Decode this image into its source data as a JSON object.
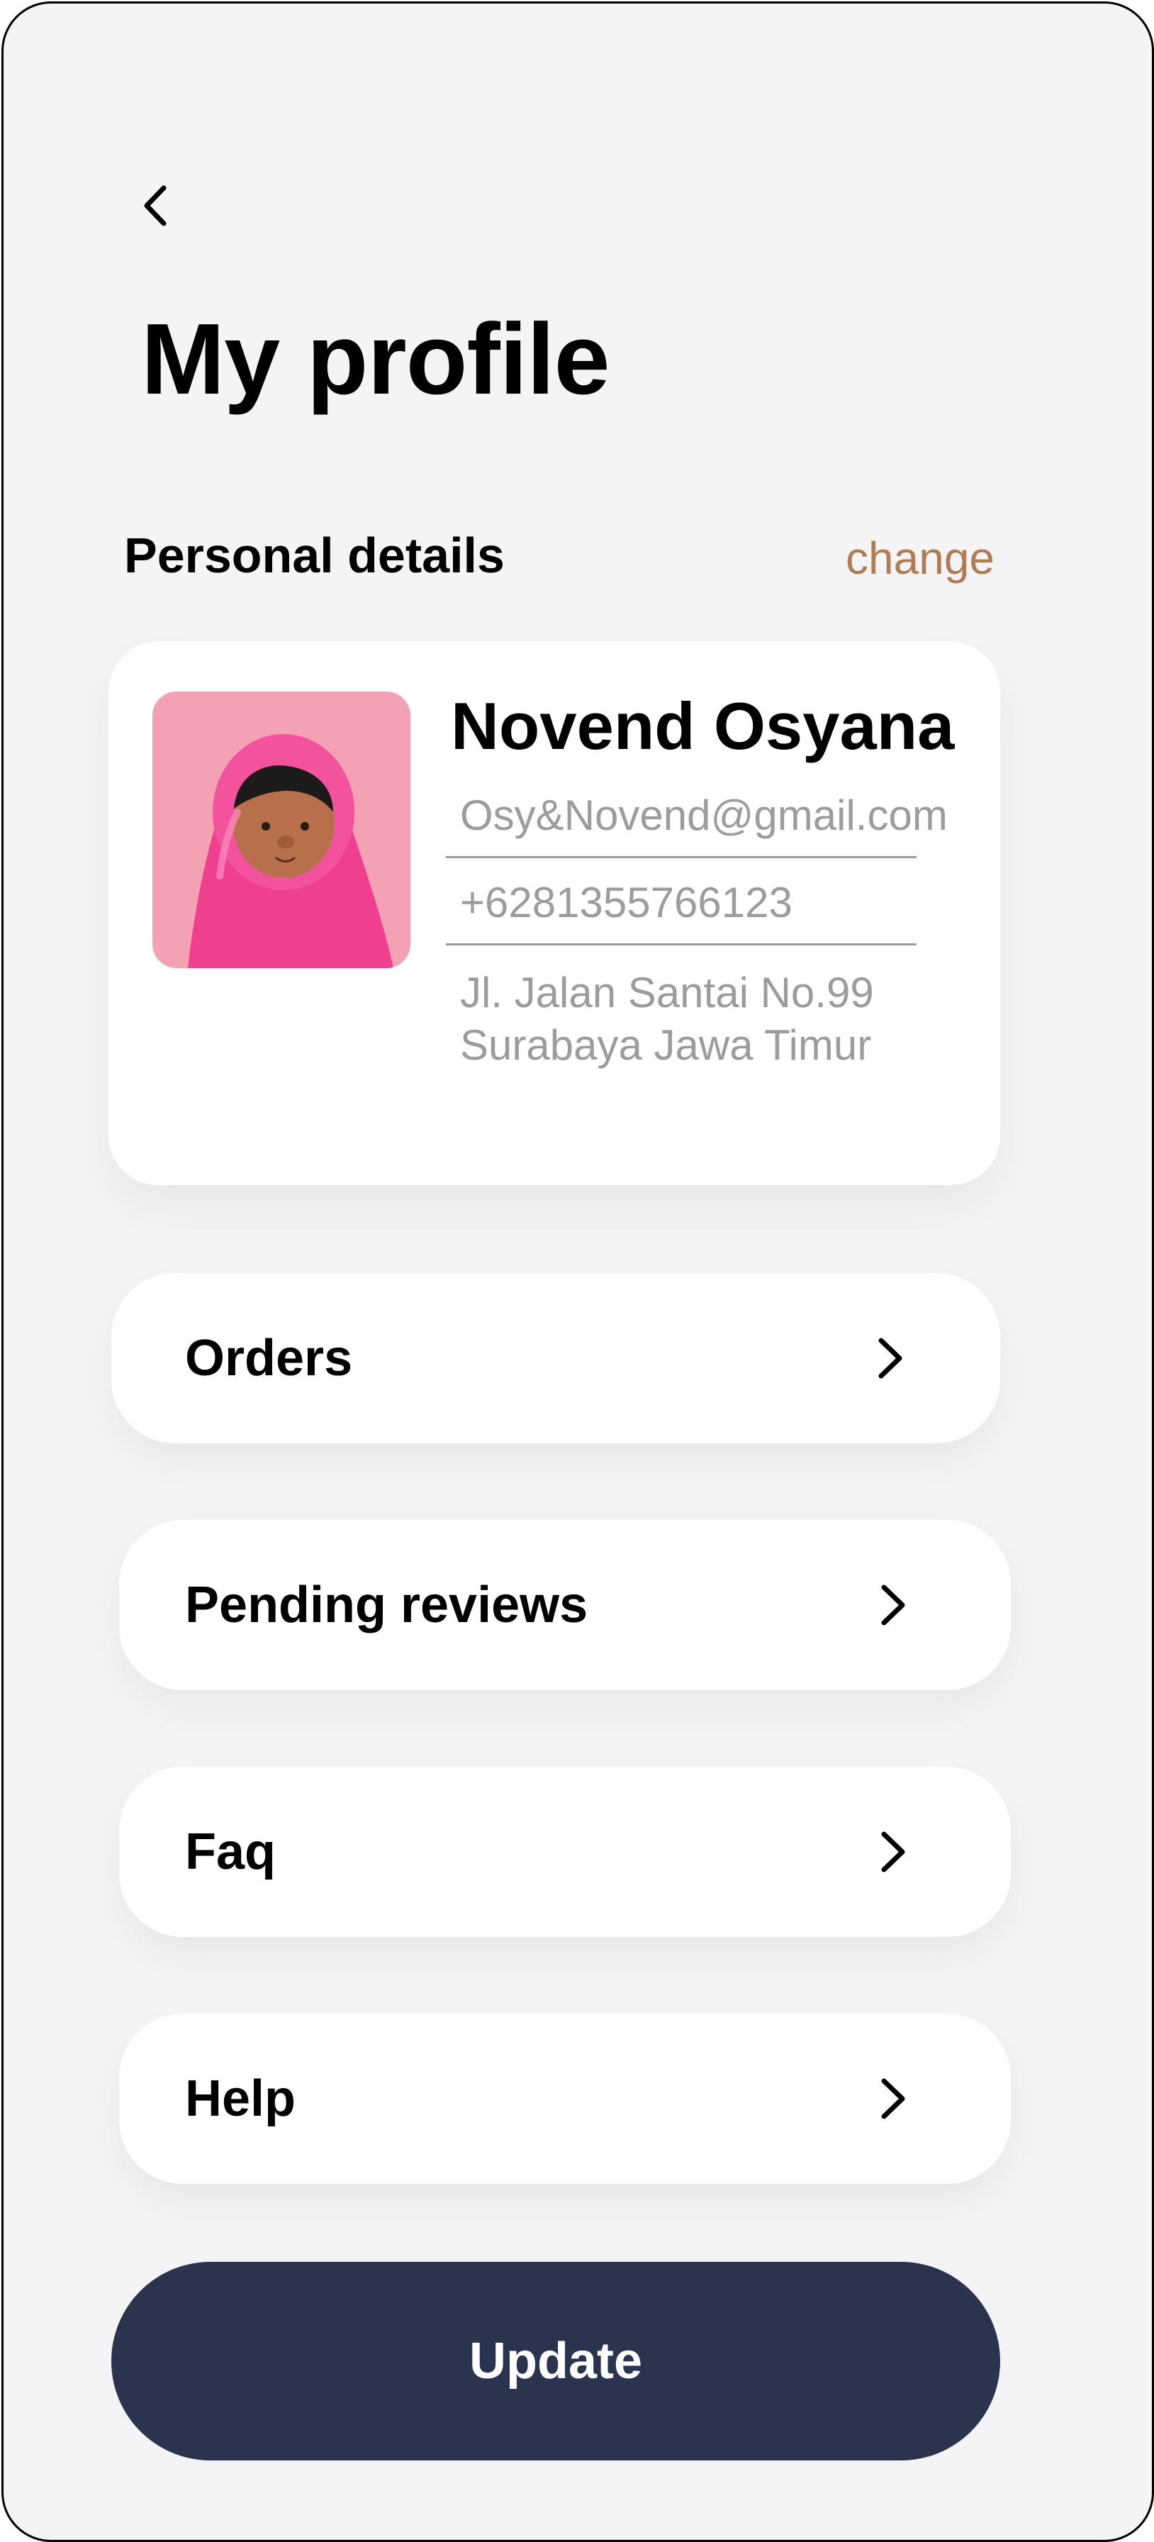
{
  "header": {
    "back_icon": "chevron-left-icon",
    "title": "My profile"
  },
  "personal_details": {
    "section_title": "Personal details",
    "change_label": "change",
    "name": "Novend Osyana",
    "email": "Osy&Novend@gmail.com",
    "phone": "+6281355766123",
    "address_line1": "Jl. Jalan Santai No.99",
    "address_line2": "Surabaya Jawa Timur"
  },
  "menu": [
    {
      "label": "Orders",
      "icon": "chevron-right-icon"
    },
    {
      "label": "Pending reviews",
      "icon": "chevron-right-icon"
    },
    {
      "label": "Faq",
      "icon": "chevron-right-icon"
    },
    {
      "label": "Help",
      "icon": "chevron-right-icon"
    }
  ],
  "footer": {
    "update_label": "Update"
  },
  "colors": {
    "background": "#f4f4f6",
    "accent_link": "#b07c52",
    "button": "#2b344f",
    "avatar_bg": "#f3a1b3"
  }
}
